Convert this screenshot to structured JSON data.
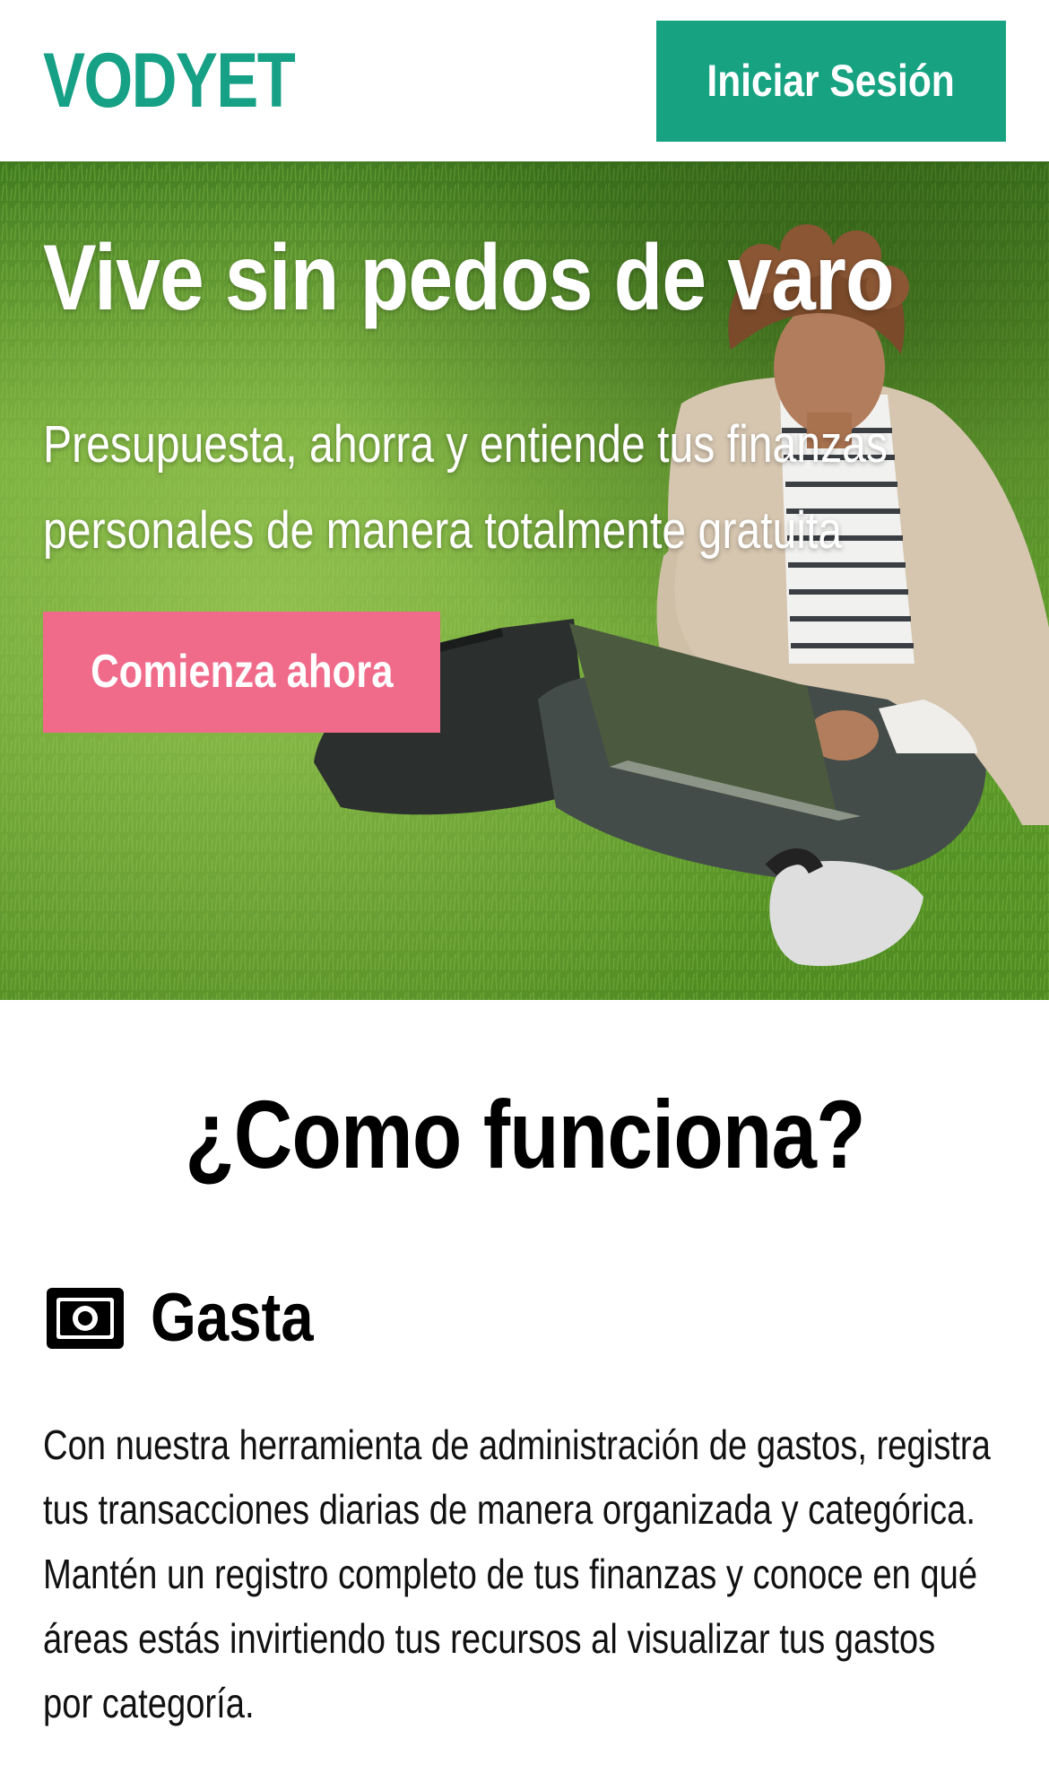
{
  "header": {
    "logo_text": "VODYET",
    "login_label": "Iniciar Sesión"
  },
  "hero": {
    "title": "Vive sin pedos de varo",
    "subtitle": "Presupuesta, ahorra y entiende tus finanzas personales de manera totalmente gratuita",
    "cta_label": "Comienza ahora",
    "image": "person-with-laptop-on-grass"
  },
  "how_it_works": {
    "title": "¿Como funciona?",
    "features": [
      {
        "icon": "money-bill-icon",
        "title": "Gasta",
        "description": "Con nuestra herramienta de administración de gastos, registra tus transacciones diarias de manera organizada y categórica. Mantén un registro completo de tus finanzas y conoce en qué áreas estás invirtiendo tus recursos al visualizar tus gastos por categoría."
      }
    ]
  },
  "colors": {
    "brand_green": "#17a382",
    "cta_pink": "#f06a8a",
    "text": "#000000",
    "background": "#ffffff"
  }
}
